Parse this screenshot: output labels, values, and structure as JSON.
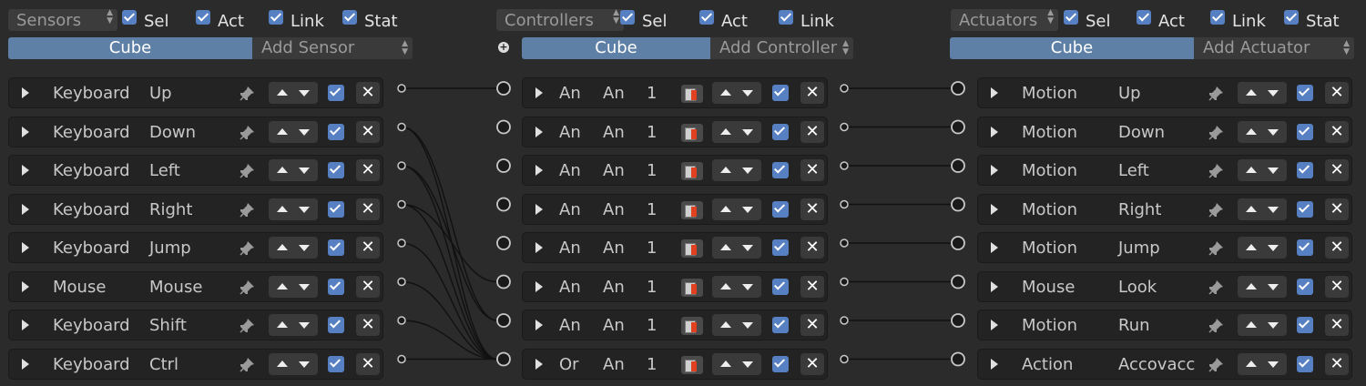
{
  "sensors": {
    "header": {
      "dropdown": "Sensors",
      "sel": "Sel",
      "act": "Act",
      "link": "Link",
      "stat": "Stat"
    },
    "object_tab": "Cube",
    "add_label": "Add Sensor",
    "rows": [
      {
        "type": "Keyboard",
        "name": "Up"
      },
      {
        "type": "Keyboard",
        "name": "Down"
      },
      {
        "type": "Keyboard",
        "name": "Left"
      },
      {
        "type": "Keyboard",
        "name": "Right"
      },
      {
        "type": "Keyboard",
        "name": "Jump"
      },
      {
        "type": "Mouse",
        "name": "Mouse"
      },
      {
        "type": "Keyboard",
        "name": "Shift"
      },
      {
        "type": "Keyboard",
        "name": "Ctrl"
      }
    ]
  },
  "controllers": {
    "header": {
      "dropdown": "Controllers",
      "sel": "Sel",
      "act": "Act",
      "link": "Link"
    },
    "object_tab": "Cube",
    "add_label": "Add Controller",
    "rows": [
      {
        "type": "An",
        "name": "An",
        "priority": "1"
      },
      {
        "type": "An",
        "name": "An",
        "priority": "1"
      },
      {
        "type": "An",
        "name": "An",
        "priority": "1"
      },
      {
        "type": "An",
        "name": "An",
        "priority": "1"
      },
      {
        "type": "An",
        "name": "An",
        "priority": "1"
      },
      {
        "type": "An",
        "name": "An",
        "priority": "1"
      },
      {
        "type": "An",
        "name": "An",
        "priority": "1"
      },
      {
        "type": "Or",
        "name": "An",
        "priority": "1"
      }
    ]
  },
  "actuators": {
    "header": {
      "dropdown": "Actuators",
      "sel": "Sel",
      "act": "Act",
      "link": "Link",
      "stat": "Stat"
    },
    "object_tab": "Cube",
    "add_label": "Add Actuator",
    "rows": [
      {
        "type": "Motion",
        "name": "Up"
      },
      {
        "type": "Motion",
        "name": "Down"
      },
      {
        "type": "Motion",
        "name": "Left"
      },
      {
        "type": "Motion",
        "name": "Right"
      },
      {
        "type": "Motion",
        "name": "Jump"
      },
      {
        "type": "Mouse",
        "name": "Look"
      },
      {
        "type": "Motion",
        "name": "Run"
      },
      {
        "type": "Action",
        "name": "Accovacc"
      }
    ]
  },
  "icons": {
    "expand": "triangle-right-icon",
    "pin": "pin-icon",
    "move": "up-down-arrows",
    "active": "checkbox-checked-icon",
    "remove": "close-x-icon",
    "state": "bookmark-state-icon",
    "add_state": "plus-circle-icon"
  },
  "colors": {
    "accent": "#5e7fa6",
    "checkbox": "#5680c2",
    "background": "#2b2b2b"
  },
  "links": {
    "sensor_to_controller": [
      [
        0,
        0
      ],
      [
        1,
        7
      ],
      [
        1,
        6
      ],
      [
        2,
        7
      ],
      [
        2,
        6
      ],
      [
        3,
        7
      ],
      [
        3,
        5
      ],
      [
        4,
        7
      ],
      [
        5,
        7
      ],
      [
        6,
        7
      ],
      [
        7,
        7
      ]
    ],
    "controller_to_actuator": [
      [
        0,
        0
      ],
      [
        1,
        1
      ],
      [
        2,
        2
      ],
      [
        3,
        3
      ],
      [
        4,
        4
      ],
      [
        5,
        5
      ],
      [
        6,
        6
      ],
      [
        7,
        7
      ]
    ]
  }
}
